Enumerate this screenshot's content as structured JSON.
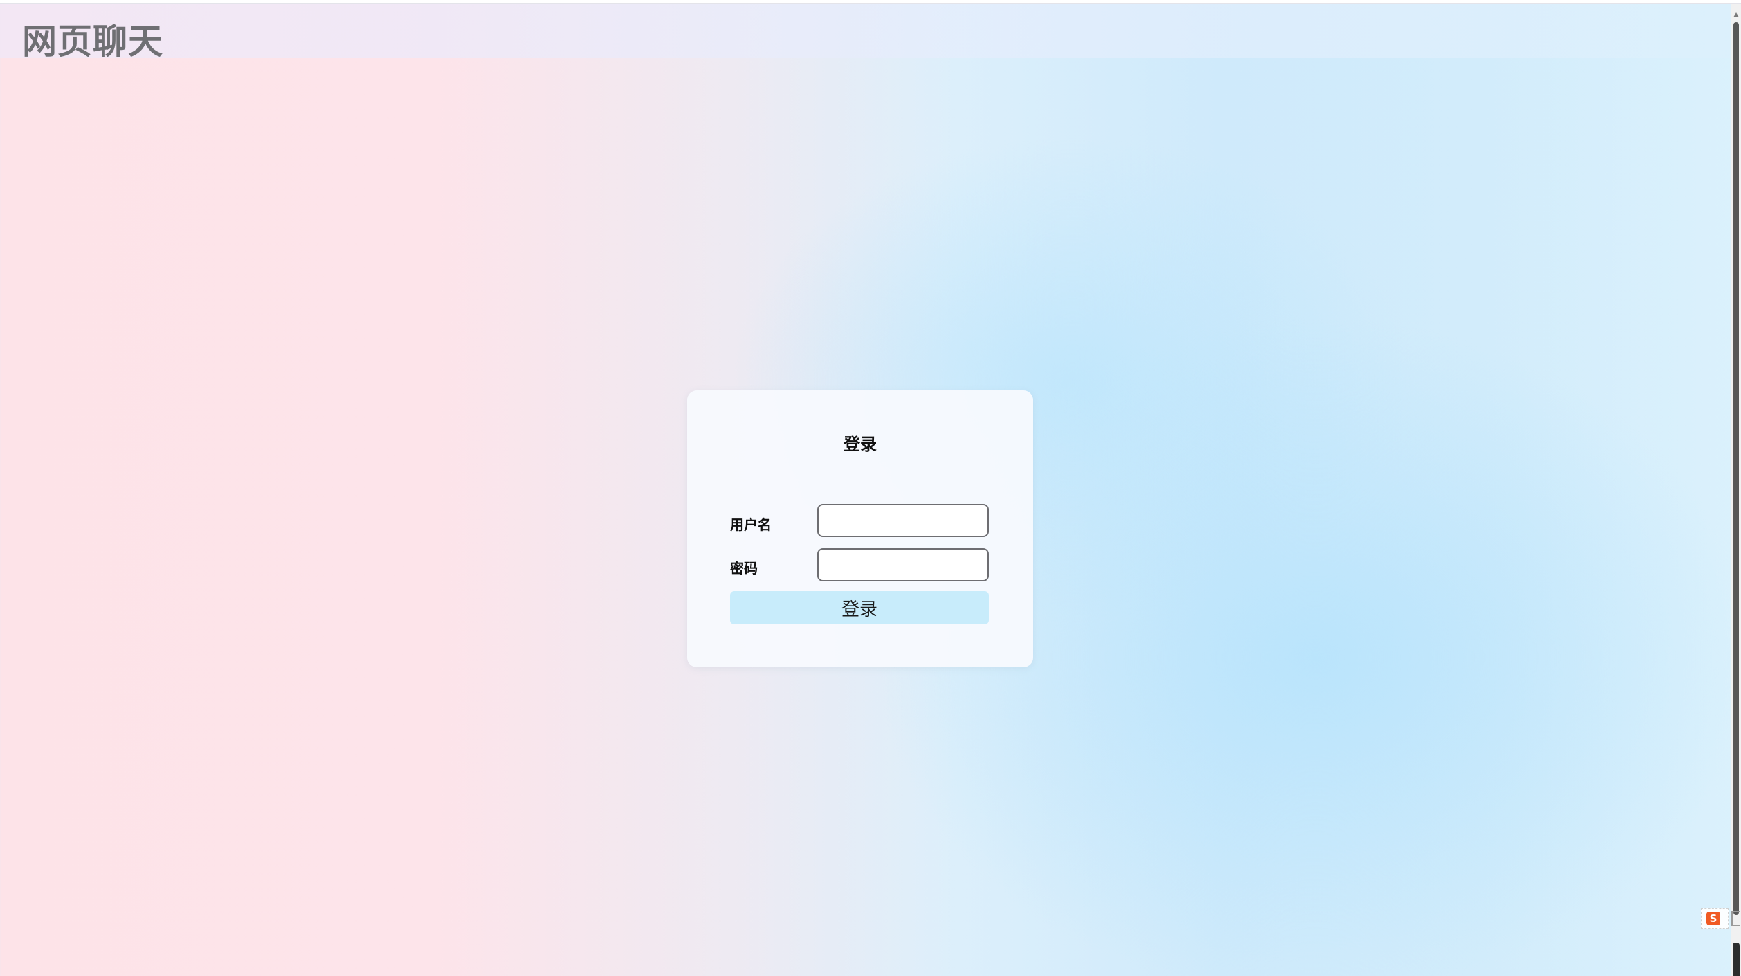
{
  "header": {
    "title": "网页聊天"
  },
  "login_form": {
    "heading": "登录",
    "username_label": "用户名",
    "username_value": "",
    "password_label": "密码",
    "password_value": "",
    "submit_label": "登录"
  },
  "ime_widget": {
    "glyph": "S"
  },
  "colors": {
    "submit_button": "#c8ecfb",
    "title_text": "#6f6f73",
    "ime_icon": "#f05a23"
  }
}
